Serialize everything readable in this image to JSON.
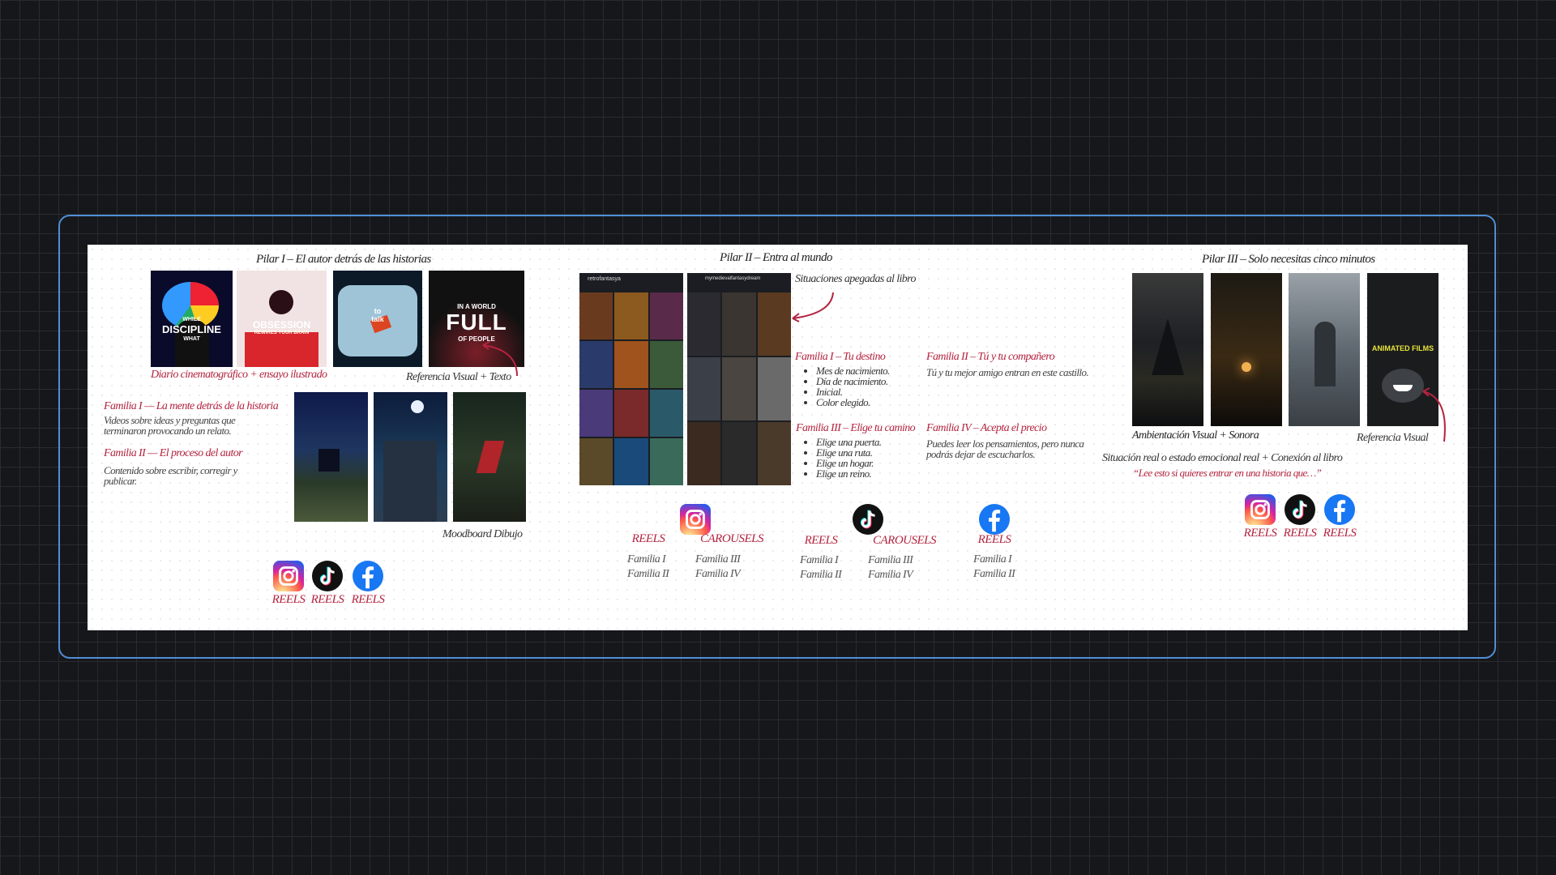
{
  "pillar1": {
    "title": "Pilar I – El autor detrás de las historias",
    "img1": {
      "line1": "WHILE",
      "line2": "DISCIPLINE",
      "line3": "WHAT"
    },
    "img2": {
      "line1": "OBSESSION",
      "line2": "REWIRES YOUR BRAIN"
    },
    "img3": {
      "line1": "to",
      "line2": "talk"
    },
    "img4": {
      "line1": "IN A WORLD",
      "line2": "FULL",
      "line3": "OF PEOPLE"
    },
    "caption_left": "Diario cinematográfico + ensayo ilustrado",
    "caption_right": "Referencia Visual + Texto",
    "family1_title": "Familia I — La mente detrás de la historia",
    "family1_text": "Videos sobre ideas y preguntas que terminaron provocando un relato.",
    "family2_title": "Familia II — El proceso del autor",
    "family2_text": "Contenido sobre escribir, corregir y publicar.",
    "moodboard": "Moodboard Dibujo",
    "icons": [
      {
        "name": "instagram-icon",
        "label": "REELS"
      },
      {
        "name": "tiktok-icon",
        "label": "REELS"
      },
      {
        "name": "facebook-icon",
        "label": "REELS"
      }
    ]
  },
  "pillar2": {
    "title": "Pilar II – Entra al mundo",
    "phone1_handle": "retrofantasya",
    "phone2_handle": "mymedievalfantasydream",
    "annotation": "Situaciones apegadas al libro",
    "family1_title": "Familia I – Tu destino",
    "family1_items": [
      "Mes de nacimiento.",
      "Día de nacimiento.",
      "Inicial.",
      "Color elegido."
    ],
    "family2_title": "Familia II – Tú y tu compañero",
    "family2_text": "Tú y tu mejor amigo entran en este castillo.",
    "family3_title": "Familia III – Elige tu camino",
    "family3_items": [
      "Elige una puerta.",
      "Elige una ruta.",
      "Elige un hogar.",
      "Elige un reino."
    ],
    "family4_title": "Familia IV – Acepta el precio",
    "family4_text": "Puedes leer los pensamientos, pero nunca podrás dejar de escucharlos.",
    "platforms": {
      "instagram": {
        "reels_label": "REELS",
        "reels_items": [
          "Familia I",
          "Familia II"
        ],
        "carousels_label": "CAROUSELS",
        "carousels_items": [
          "Familia III",
          "Familia IV"
        ]
      },
      "tiktok": {
        "reels_label": "REELS",
        "reels_items": [
          "Familia I",
          "Familia II"
        ],
        "carousels_label": "CAROUSELS",
        "carousels_items": [
          "Familia III",
          "Familia IV"
        ]
      },
      "facebook": {
        "reels_label": "REELS",
        "reels_items": [
          "Familia I",
          "Familia II"
        ]
      }
    }
  },
  "pillar3": {
    "title": "Pilar III – Solo necesitas cinco minutos",
    "img4_text": "ANIMATED FILMS",
    "caption_left": "Ambientación Visual + Sonora",
    "caption_right": "Referencia Visual",
    "description": "Situación real o estado emocional real + Conexión al libro",
    "quote": "“Lee esto si quieres entrar en una historia que…”",
    "icons": [
      {
        "name": "instagram-icon",
        "label": "REELS"
      },
      {
        "name": "tiktok-icon",
        "label": "REELS"
      },
      {
        "name": "facebook-icon",
        "label": "REELS"
      }
    ]
  },
  "colors": {
    "accent_red": "#b3243f",
    "frame_blue": "#4f8fd6",
    "background": "#16171a"
  }
}
